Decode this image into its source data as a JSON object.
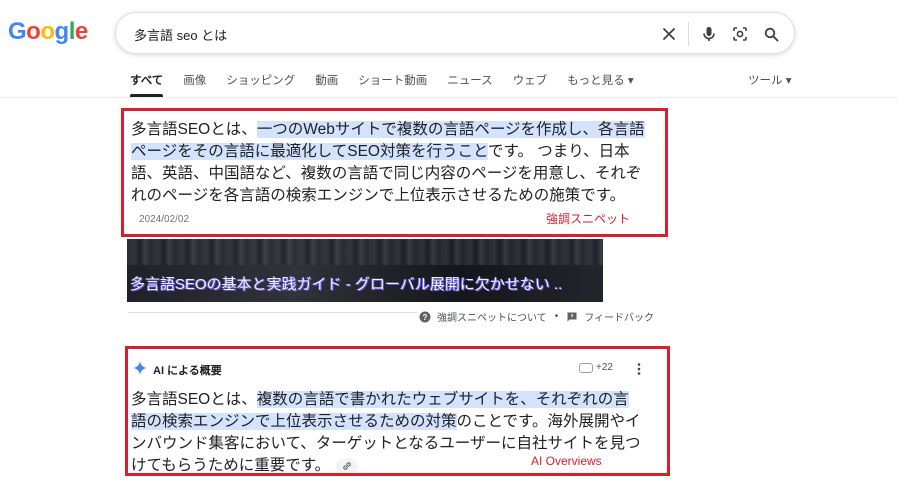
{
  "header": {
    "logo_letters": [
      {
        "ch": "G",
        "color": "#4285f4"
      },
      {
        "ch": "o",
        "color": "#ea4335"
      },
      {
        "ch": "o",
        "color": "#fbbc05"
      },
      {
        "ch": "g",
        "color": "#4285f4"
      },
      {
        "ch": "l",
        "color": "#34a853"
      },
      {
        "ch": "e",
        "color": "#ea4335"
      }
    ],
    "query": "多言語 seo とは",
    "icons": [
      "close-icon",
      "mic-icon",
      "lens-icon",
      "search-icon"
    ]
  },
  "tabs": [
    {
      "label": "すべて",
      "active": true
    },
    {
      "label": "画像"
    },
    {
      "label": "ショッピング"
    },
    {
      "label": "動画"
    },
    {
      "label": "ショート動画"
    },
    {
      "label": "ニュース"
    },
    {
      "label": "ウェブ"
    },
    {
      "label": "もっと見る ▾"
    }
  ],
  "tools_label": "ツール ▾",
  "snippet": {
    "pre": "多言語SEOとは、",
    "highlight": "一つのWebサイトで複数の言語ページを作成し、各言語ページをその言語に最適化してSEO対策を行うこと",
    "post": "です。 つまり、日本語、英語、中国語など、複数の言語で同じ内容のページを用意し、それぞれのページを各言語の検索エンジンで上位表示させるための施策です。",
    "date": "2024/02/02",
    "annotation": "強調スニペット",
    "image_title": "多言語SEOの基本と実践ガイド - グローバル展開に欠かせない ..",
    "about_label": "強調スニペットについて",
    "separator": "•",
    "feedback_label": "フィードバック"
  },
  "ai_overview": {
    "title": "AI による概要",
    "source_count": "+22",
    "pre": "多言語SEOとは、",
    "highlight": "複数の言語で書かれたウェブサイトを、それぞれの言語の検索エンジンで上位表示させるための対策",
    "post": "のことです。海外展開やインバウンド集客において、ターゲットとなるユーザーに自社サイトを見つけてもらうために重要です。",
    "annotation": "AI Overviews"
  },
  "colors": {
    "annotation_red": "#d91e2c",
    "highlight": "#d3e3fd",
    "gemini_blue": "#4285f4"
  }
}
